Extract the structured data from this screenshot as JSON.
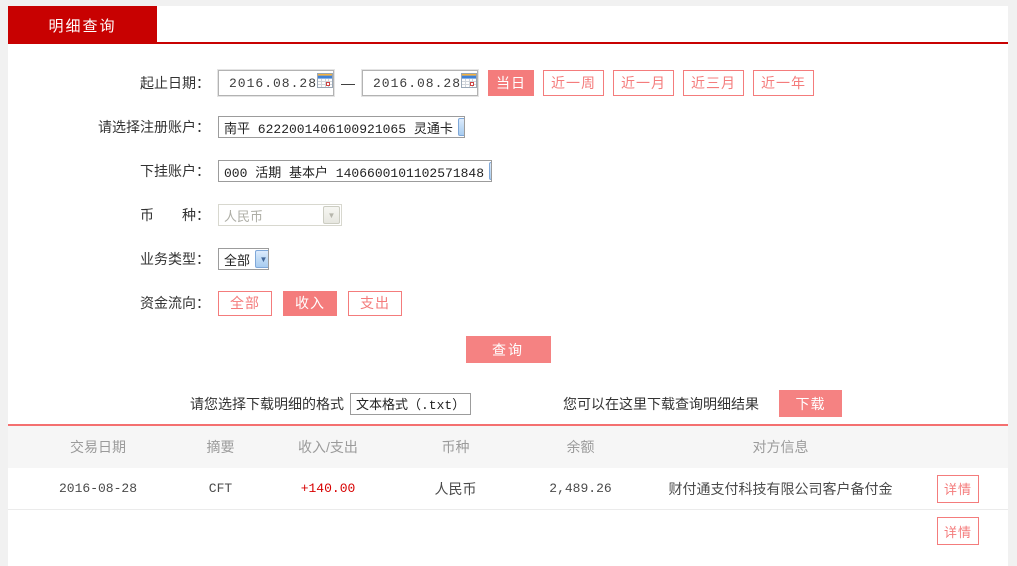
{
  "colors": {
    "brand_red": "#c80101",
    "accent_salmon": "#f47c7c",
    "amount_red": "#d70000",
    "page_bg": "#f1f1f1"
  },
  "tab": {
    "label": "明细查询"
  },
  "form": {
    "date_range": {
      "label": "起止日期：",
      "start": "2016.08.28",
      "separator": "—",
      "end": "2016.08.28",
      "quick_buttons": [
        {
          "label": "当日",
          "active": true
        },
        {
          "label": "近一周",
          "active": false
        },
        {
          "label": "近一月",
          "active": false
        },
        {
          "label": "近三月",
          "active": false
        },
        {
          "label": "近一年",
          "active": false
        }
      ]
    },
    "register_account": {
      "label": "请选择注册账户：",
      "value": "南平 6222001406100921065 灵通卡"
    },
    "sub_account": {
      "label": "下挂账户：",
      "value": "000 活期 基本户 1406600101102571848"
    },
    "currency": {
      "label": "币　　种：",
      "value": "人民币",
      "disabled": true
    },
    "business_type": {
      "label": "业务类型：",
      "value": "全部"
    },
    "fund_flow": {
      "label": "资金流向：",
      "options": [
        {
          "label": "全部",
          "active": false
        },
        {
          "label": "收入",
          "active": true
        },
        {
          "label": "支出",
          "active": false
        }
      ]
    },
    "query_button_label": "查询"
  },
  "download": {
    "format_label": "请您选择下载明细的格式",
    "format_value": "文本格式（.txt）",
    "hint": "您可以在这里下载查询明细结果",
    "button_label": "下载"
  },
  "table": {
    "headers": [
      "交易日期",
      "摘要",
      "收入/支出",
      "币种",
      "余额",
      "对方信息"
    ],
    "action_label": "详情",
    "rows": [
      {
        "date": "2016-08-28",
        "summary": "CFT",
        "amount": "+140.00",
        "currency": "人民币",
        "balance": "2,489.26",
        "counterparty": "财付通支付科技有限公司客户备付金"
      }
    ]
  }
}
